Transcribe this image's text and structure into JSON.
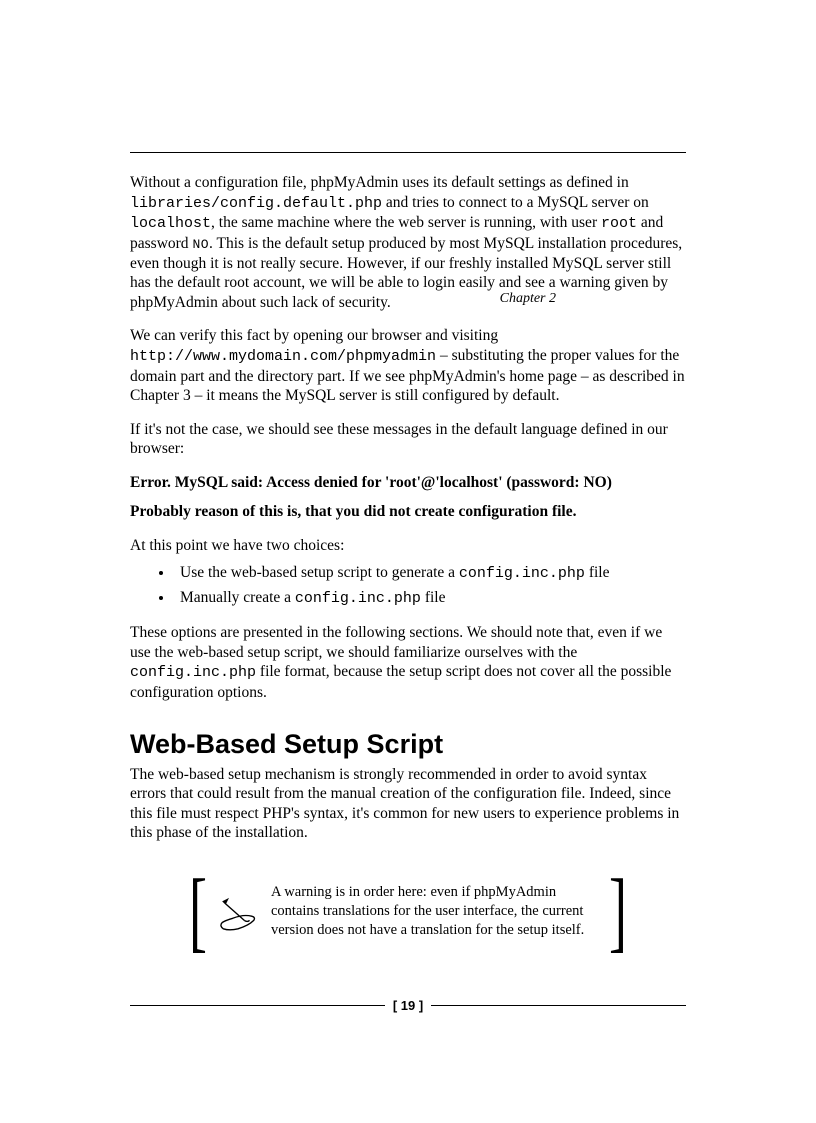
{
  "header": {
    "chapter_label": "Chapter 2"
  },
  "body": {
    "p1_a": "Without a configuration file, phpMyAdmin uses its default settings as defined in ",
    "p1_code1": "libraries/config.default.php",
    "p1_b": " and tries to connect to a MySQL server on ",
    "p1_code2": "localhost",
    "p1_c": ", the same machine where the web server is running, with user ",
    "p1_code3": "root",
    "p1_d": " and password ",
    "p1_sc1": "NO",
    "p1_e": ". This is the default setup produced by most MySQL installation procedures, even though it is not really secure. However, if our freshly installed MySQL server still has the default root account, we will be able to login easily and see a warning given by phpMyAdmin about such lack of security.",
    "p2_a": "We can verify this fact by opening our browser and visiting ",
    "p2_code1": "http://www.mydomain.com/phpmyadmin",
    "p2_b": " – substituting the proper values for the domain part and the directory part. If we see phpMyAdmin's home page – as described in Chapter 3 – it means the MySQL server is still configured by default.",
    "p3": "If it's not the case, we should see these messages in the default language defined in our browser:",
    "err1": "Error. MySQL said: Access denied for 'root'@'localhost' (password: NO)",
    "err2": "Probably  reason of this is, that you did not create configuration file.",
    "p4": "At this point we have two choices:",
    "li1_a": "Use the web-based setup script to generate a ",
    "li1_code": "config.inc.php",
    "li1_b": " file",
    "li2_a": "Manually create a ",
    "li2_code": "config.inc.php",
    "li2_b": " file",
    "p5_a": "These options are presented in the following sections. We should note that, even if we use the web-based setup script, we should familiarize ourselves with the ",
    "p5_code": "config.inc.php",
    "p5_b": " file format, because the setup script does not cover all the possible configuration options.",
    "h2": "Web-Based Setup Script",
    "p6": "The web-based setup mechanism is strongly recommended in order to avoid syntax errors that could result from the manual creation of the configuration file. Indeed, since this file must respect PHP's syntax, it's common for new users to experience problems in this phase of the installation.",
    "callout": "A warning is in order here: even if phpMyAdmin contains translations for the user interface, the current version does not have a translation for the setup itself."
  },
  "footer": {
    "page_number": "[ 19 ]"
  }
}
